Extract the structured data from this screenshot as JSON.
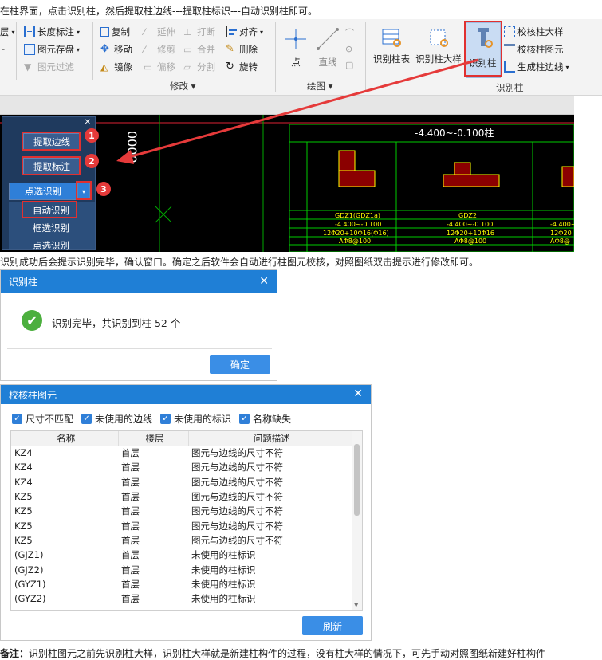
{
  "intro_text": "在柱界面，点击识别柱，然后提取柱边线---提取柱标识---自动识别柱即可。",
  "ribbon": {
    "col0": [
      {
        "label": "层",
        "icon": "layer-icon"
      },
      {
        "label": "",
        "icon": "dash-icon"
      }
    ],
    "col1": [
      {
        "label": "长度标注",
        "icon": "dimension-icon",
        "disabled": false
      },
      {
        "label": "图元存盘",
        "icon": "save-icon",
        "disabled": false
      },
      {
        "label": "图元过滤",
        "icon": "filter-icon",
        "disabled": true
      }
    ],
    "modify": [
      {
        "label": "复制",
        "icon": "copy-icon",
        "disabled": false
      },
      {
        "label": "延伸",
        "icon": "extend-icon",
        "disabled": true
      },
      {
        "label": "打断",
        "icon": "break-icon",
        "disabled": true
      },
      {
        "label": "对齐",
        "icon": "align-icon",
        "disabled": false,
        "dropdown": true
      },
      {
        "label": "移动",
        "icon": "move-icon",
        "disabled": false
      },
      {
        "label": "修剪",
        "icon": "trim-icon",
        "disabled": true
      },
      {
        "label": "合并",
        "icon": "merge-icon",
        "disabled": true
      },
      {
        "label": "删除",
        "icon": "delete-icon",
        "disabled": false
      },
      {
        "label": "镜像",
        "icon": "mirror-icon",
        "disabled": false
      },
      {
        "label": "偏移",
        "icon": "offset-icon",
        "disabled": true
      },
      {
        "label": "分割",
        "icon": "split-icon",
        "disabled": true
      },
      {
        "label": "旋转",
        "icon": "rotate-icon",
        "disabled": false
      }
    ],
    "modify_label": "修改",
    "draw": [
      {
        "label": "点",
        "icon": "point-icon"
      },
      {
        "label": "直线",
        "icon": "line-icon"
      }
    ],
    "draw_label": "绘图",
    "recog": [
      {
        "label": "识别柱表"
      },
      {
        "label": "识别柱大样"
      },
      {
        "label": "识别柱"
      }
    ],
    "recog_side": [
      {
        "label": "校核柱大样"
      },
      {
        "label": "校核柱图元"
      },
      {
        "label": "生成柱边线"
      }
    ],
    "recog_label": "识别柱"
  },
  "cad": {
    "title": "-4.400~-0.100柱",
    "rows": [
      [
        "GDZ1(GDZ1a)",
        "GDZ2",
        ""
      ],
      [
        "-4.400~-0.100",
        "-4.400~-0.100",
        "-4.400~"
      ],
      [
        "12Φ20+10Φ16(Φ16)",
        "12Φ20+10Φ16",
        "12Φ20"
      ],
      [
        "AΦ8@100",
        "AΦ8@100",
        "AΦ8@"
      ]
    ]
  },
  "float_panel": {
    "extract_edge": "提取边线",
    "extract_mark": "提取标注",
    "point_recog": "点选识别",
    "menu": [
      "自动识别",
      "框选识别",
      "点选识别"
    ],
    "badges": [
      "1",
      "2",
      "3"
    ]
  },
  "text2": "识别成功后会提示识别完毕，确认窗口。确定之后软件会自动进行柱图元校核，对照图纸双击提示进行修改即可。",
  "dialog1": {
    "title": "识别柱",
    "message": "识别完毕，共识别到柱 52 个",
    "ok": "确定"
  },
  "dialog2": {
    "title": "校核柱图元",
    "checks": [
      {
        "label": "尺寸不匹配",
        "checked": true
      },
      {
        "label": "未使用的边线",
        "checked": true
      },
      {
        "label": "未使用的标识",
        "checked": true
      },
      {
        "label": "名称缺失",
        "checked": true
      }
    ],
    "columns": [
      "名称",
      "楼层",
      "问题描述"
    ],
    "rows": [
      [
        "KZ4",
        "首层",
        "图元与边线的尺寸不符"
      ],
      [
        "KZ4",
        "首层",
        "图元与边线的尺寸不符"
      ],
      [
        "KZ4",
        "首层",
        "图元与边线的尺寸不符"
      ],
      [
        "KZ5",
        "首层",
        "图元与边线的尺寸不符"
      ],
      [
        "KZ5",
        "首层",
        "图元与边线的尺寸不符"
      ],
      [
        "KZ5",
        "首层",
        "图元与边线的尺寸不符"
      ],
      [
        "KZ5",
        "首层",
        "图元与边线的尺寸不符"
      ],
      [
        "(GJZ1)",
        "首层",
        "未使用的柱标识"
      ],
      [
        "(GJZ2)",
        "首层",
        "未使用的柱标识"
      ],
      [
        "(GYZ1)",
        "首层",
        "未使用的柱标识"
      ],
      [
        "(GYZ2)",
        "首层",
        "未使用的柱标识"
      ]
    ],
    "refresh": "刷新"
  },
  "note": {
    "label": "备注：",
    "text": "识别柱图元之前先识别柱大样，识别柱大样就是新建柱构件的过程，没有柱大样的情况下，可先手动对照图纸新建好柱构件"
  }
}
